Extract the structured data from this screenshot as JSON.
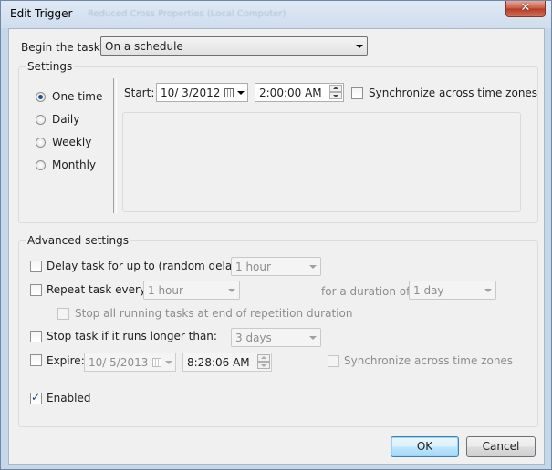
{
  "window": {
    "title": "Edit Trigger",
    "ghost_title": "Reduced Cross Properties (Local Computer)"
  },
  "begin_task": {
    "label": "Begin the task:",
    "value": "On a schedule"
  },
  "settings": {
    "legend": "Settings",
    "options": [
      "One time",
      "Daily",
      "Weekly",
      "Monthly"
    ],
    "selected": "One time",
    "start_label": "Start:",
    "start_date": "10/  3/2012",
    "start_time": "2:00:00 AM",
    "sync_label": "Synchronize across time zones"
  },
  "advanced": {
    "legend": "Advanced settings",
    "delay_label": "Delay task for up to (random delay):",
    "delay_value": "1 hour",
    "repeat_label": "Repeat task every:",
    "repeat_value": "1 hour",
    "duration_label": "for a duration of:",
    "duration_value": "1 day",
    "stop_running_label": "Stop all running tasks at end of repetition duration",
    "stop_longer_label": "Stop task if it runs longer than:",
    "stop_longer_value": "3 days",
    "expire_label": "Expire:",
    "expire_date": "10/  5/2013",
    "expire_time": "8:28:06 AM",
    "expire_sync_label": "Synchronize across time zones",
    "enabled_label": "Enabled",
    "enabled_checked": true
  },
  "buttons": {
    "ok": "OK",
    "cancel": "Cancel"
  },
  "icons": {
    "close": "close-icon",
    "dropdown": "chevron-down-icon",
    "calendar": "calendar-icon",
    "check": "checkmark-icon"
  }
}
